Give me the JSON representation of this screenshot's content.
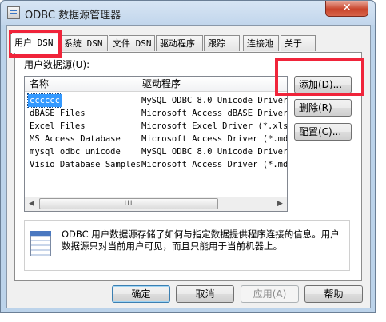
{
  "window": {
    "title": "ODBC 数据源管理器",
    "close_glyph": "✕"
  },
  "tabs": [
    {
      "label": "用户 DSN",
      "active": true
    },
    {
      "label": "系统 DSN",
      "active": false
    },
    {
      "label": "文件 DSN",
      "active": false
    },
    {
      "label": "驱动程序",
      "active": false
    },
    {
      "label": "跟踪",
      "active": false
    },
    {
      "label": "连接池",
      "active": false
    },
    {
      "label": "关于",
      "active": false
    }
  ],
  "user_dsn": {
    "section_label": "用户数据源(U):",
    "columns": {
      "name": "名称",
      "driver": "驱动程序"
    },
    "rows": [
      {
        "name": "cccccc",
        "driver": "MySQL ODBC 8.0 Unicode Driver",
        "selected": true
      },
      {
        "name": "dBASE Files",
        "driver": "Microsoft Access dBASE Driver",
        "selected": false
      },
      {
        "name": "Excel Files",
        "driver": "Microsoft Excel Driver (*.xls,",
        "selected": false
      },
      {
        "name": "MS Access Database",
        "driver": "Microsoft Access Driver (*.mdb",
        "selected": false
      },
      {
        "name": "mysql odbc unicode",
        "driver": "MySQL ODBC 8.0 Unicode Driver",
        "selected": false
      },
      {
        "name": "Visio Database Samples",
        "driver": "Microsoft Access Driver (*.mdb",
        "selected": false
      }
    ],
    "scrollbar": {
      "left_arrow": "◀",
      "right_arrow": "▶",
      "thumb_grip": "III"
    }
  },
  "side_buttons": {
    "add": "添加(D)...",
    "remove": "删除(R)",
    "configure": "配置(C)..."
  },
  "info": {
    "text": "ODBC 用户数据源存储了如何与指定数据提供程序连接的信息。用户数据源只对当前用户可见，而且只能用于当前机器上。"
  },
  "footer_buttons": {
    "ok": "确定",
    "cancel": "取消",
    "apply": "应用(A)",
    "help": "帮助"
  },
  "colors": {
    "highlight": "#f0243a",
    "selection": "#3399ff"
  }
}
